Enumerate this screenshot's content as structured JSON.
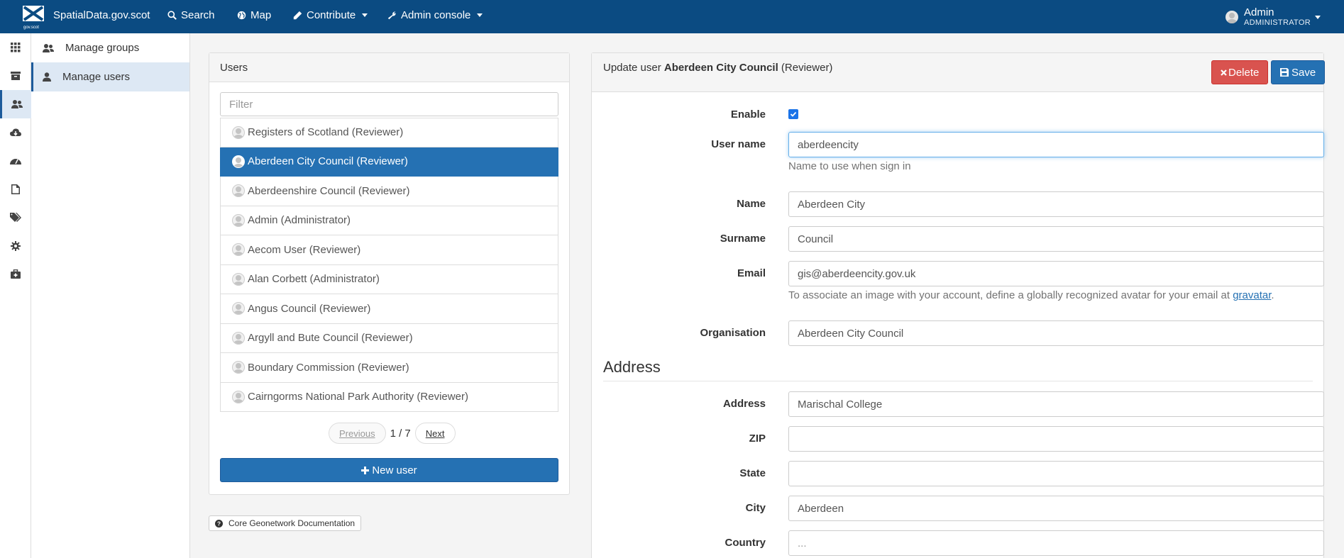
{
  "header": {
    "brand": "SpatialData.gov.scot",
    "logo_text": "gov.scot",
    "nav": [
      {
        "label": "Search",
        "icon": "search-icon"
      },
      {
        "label": "Map",
        "icon": "globe-icon"
      },
      {
        "label": "Contribute",
        "icon": "pencil-icon"
      },
      {
        "label": "Admin console",
        "icon": "wrench-icon"
      }
    ],
    "user": {
      "name": "Admin",
      "role": "ADMINISTRATOR"
    }
  },
  "iconbar": [
    "dashboard-icon",
    "archive-icon",
    "users-icon",
    "cloud-download-icon",
    "dashboard-gauge-icon",
    "file-icon",
    "tags-icon",
    "gear-icon",
    "medkit-icon"
  ],
  "sidebar": {
    "items": [
      {
        "label": "Manage groups",
        "icon": "users-icon"
      },
      {
        "label": "Manage users",
        "icon": "user-icon"
      }
    ]
  },
  "users_panel": {
    "title": "Users",
    "filter_placeholder": "Filter",
    "users": [
      "Registers of Scotland (Reviewer)",
      "Aberdeen City Council (Reviewer)",
      "Aberdeenshire Council (Reviewer)",
      "Admin (Administrator)",
      "Aecom User (Reviewer)",
      "Alan Corbett (Administrator)",
      "Angus Council (Reviewer)",
      "Argyll and Bute Council (Reviewer)",
      "Boundary Commission (Reviewer)",
      "Cairngorms National Park Authority (Reviewer)"
    ],
    "selected_index": 1,
    "pager": {
      "previous": "Previous",
      "page": "1 / 7",
      "next": "Next"
    },
    "new_user": "New user"
  },
  "doc_link": "Core Geonetwork Documentation",
  "edit": {
    "title_prefix": "Update user",
    "title_name": "Aberdeen City Council",
    "title_suffix": "(Reviewer)",
    "delete": "Delete",
    "save": "Save",
    "enable_label": "Enable",
    "enabled": true,
    "username_label": "User name",
    "username": "aberdeencity",
    "username_help": "Name to use when sign in",
    "name_label": "Name",
    "name": "Aberdeen City",
    "surname_label": "Surname",
    "surname": "Council",
    "email_label": "Email",
    "email": "gis@aberdeencity.gov.uk",
    "email_help": "To associate an image with your account, define a globally recognized avatar for your email at",
    "email_help_link": "gravatar",
    "org_label": "Organisation",
    "org": "Aberdeen City Council",
    "address_section": "Address",
    "address_label": "Address",
    "address": "Marischal College",
    "zip_label": "ZIP",
    "zip": "",
    "state_label": "State",
    "state": "",
    "city_label": "City",
    "city": "Aberdeen",
    "country_label": "Country",
    "country_placeholder": "..."
  }
}
